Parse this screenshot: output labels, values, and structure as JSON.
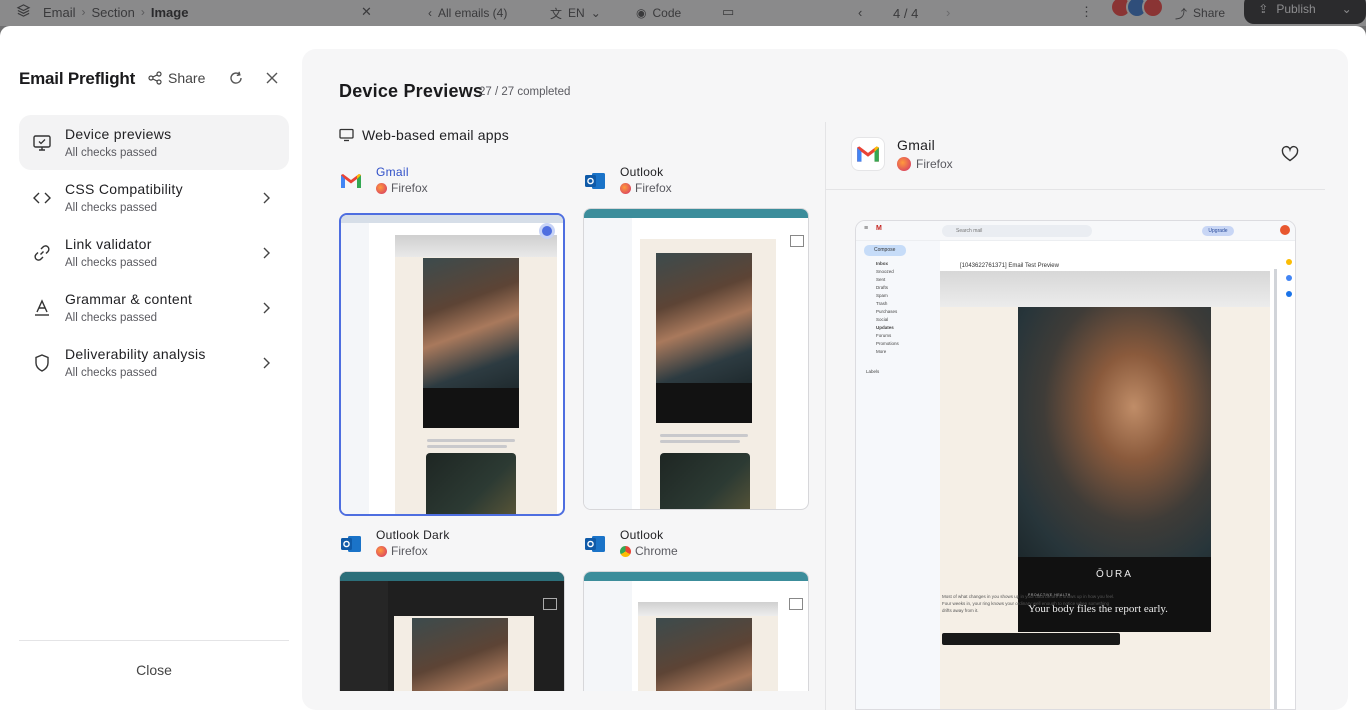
{
  "topbar": {
    "breadcrumb": [
      "Email",
      "Section",
      "Image"
    ],
    "all_emails": "All emails (4)",
    "language": "EN",
    "code": "Code",
    "pager": "4 / 4",
    "share": "Share",
    "publish": "Publish"
  },
  "sidebar": {
    "title": "Email Preflight",
    "share": "Share",
    "close": "Close",
    "items": [
      {
        "title": "Device previews",
        "status": "All checks passed",
        "icon": "monitor-icon"
      },
      {
        "title": "CSS Compatibility",
        "status": "All checks passed",
        "icon": "code-icon"
      },
      {
        "title": "Link validator",
        "status": "All checks passed",
        "icon": "link-icon"
      },
      {
        "title": "Grammar & content",
        "status": "All checks passed",
        "icon": "grammar-icon"
      },
      {
        "title": "Deliverability analysis",
        "status": "All checks passed",
        "icon": "shield-icon"
      }
    ]
  },
  "main": {
    "title": "Device Previews",
    "count": "27 / 27 completed",
    "section": "Web-based email apps",
    "cards": [
      {
        "app": "Gmail",
        "browser": "Firefox"
      },
      {
        "app": "Outlook",
        "browser": "Firefox"
      },
      {
        "app": "Outlook Dark",
        "browser": "Firefox"
      },
      {
        "app": "Outlook",
        "browser": "Chrome"
      }
    ],
    "detail": {
      "app": "Gmail",
      "browser": "Firefox",
      "preview": {
        "search": "Search mail",
        "upgrade": "Upgrade",
        "compose": "Compose",
        "nav": [
          "Inbox",
          "Snoozed",
          "Sent",
          "Drafts",
          "Spam",
          "Trash",
          "Purchases",
          "Social",
          "Updates",
          "Forums",
          "Promotions",
          "More",
          "Labels"
        ],
        "subject": "[1043622761371] Email Test Preview",
        "brand": "ŌURA",
        "eyebrow": "PROACTIVE HEALTH",
        "headline": "Your body files the report early.",
        "body": "Most of what changes in you shows up in your data before it shows up in how you feel. Four weeks in, your ring knows your ordinary well enough to notice when something drifts away from it."
      }
    }
  },
  "colors": {
    "accent": "#4e6ee0",
    "link": "#3050c8",
    "publish_bg": "#2b2b2d"
  }
}
